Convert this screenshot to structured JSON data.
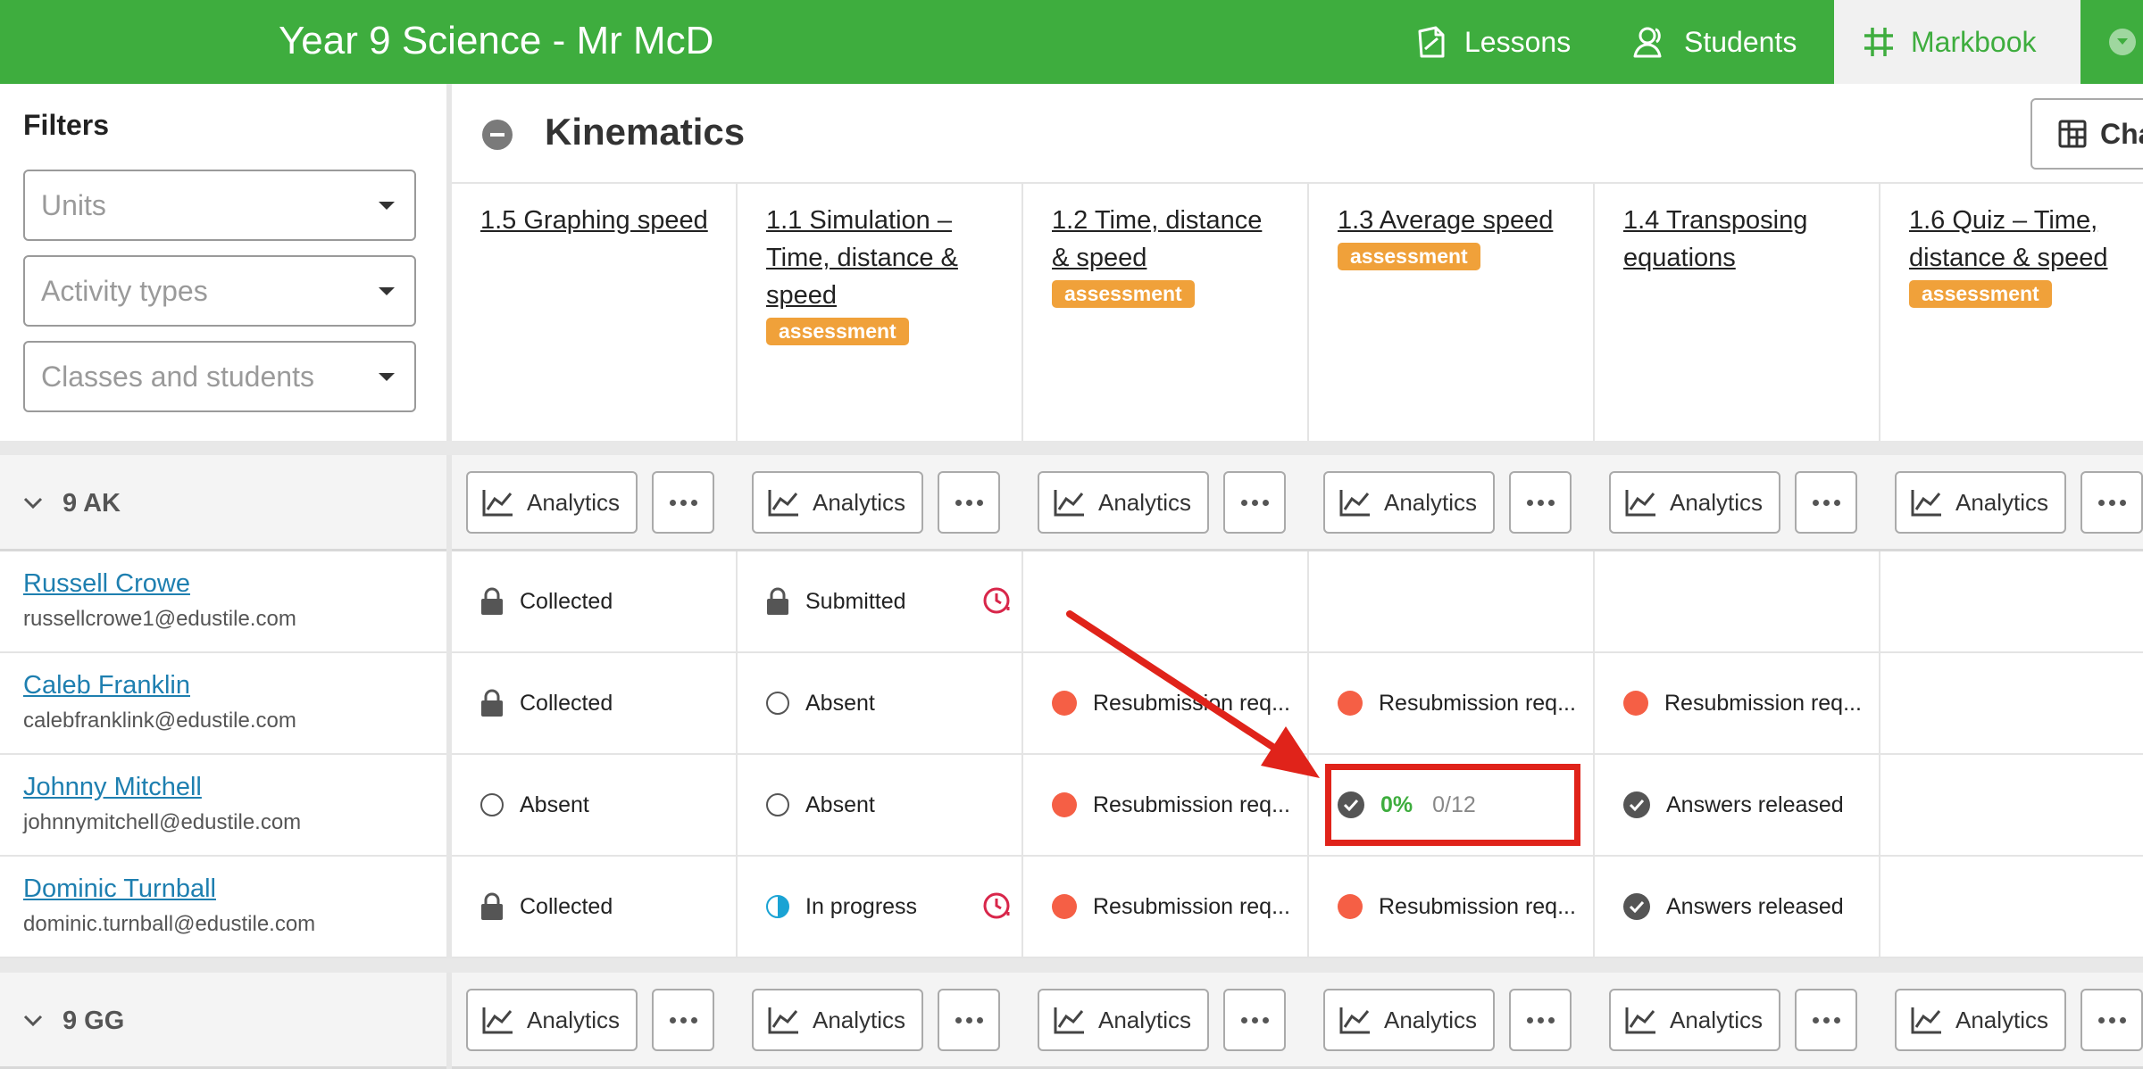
{
  "header": {
    "course_title": "Year 9 Science - Mr McD",
    "nav": {
      "lessons": "Lessons",
      "students": "Students",
      "markbook": "Markbook"
    }
  },
  "filters": {
    "title": "Filters",
    "units_placeholder": "Units",
    "activity_types_placeholder": "Activity types",
    "classes_placeholder": "Classes and students"
  },
  "unit": {
    "title": "Kinematics",
    "change_button": "Cha"
  },
  "activities": [
    {
      "title": "1.5 Graphing speed",
      "badge": ""
    },
    {
      "title": "1.1 Simulation – Time, distance & speed",
      "badge": "assessment"
    },
    {
      "title": "1.2 Time, distance & speed",
      "badge": "assessment"
    },
    {
      "title": "1.3 Average speed",
      "badge": "assessment"
    },
    {
      "title": "1.4 Transposing equations",
      "badge": ""
    },
    {
      "title": "1.6 Quiz – Time, distance & speed",
      "badge": "assessment"
    }
  ],
  "labels": {
    "analytics": "Analytics"
  },
  "classes": [
    {
      "name": "9 AK",
      "students": [
        {
          "name": "Russell Crowe",
          "email": "russellcrowe1@edustile.com",
          "cells": [
            {
              "status": "Collected",
              "icon": "lock-icon"
            },
            {
              "status": "Submitted",
              "icon": "lock-icon",
              "late": true
            },
            {
              "status": "",
              "icon": ""
            },
            {
              "status": "",
              "icon": ""
            },
            {
              "status": "",
              "icon": ""
            },
            {
              "status": "",
              "icon": ""
            }
          ]
        },
        {
          "name": "Caleb Franklin",
          "email": "calebfranklink@edustile.com",
          "cells": [
            {
              "status": "Collected",
              "icon": "lock-icon"
            },
            {
              "status": "Absent",
              "icon": "absent-circle-icon"
            },
            {
              "status": "Resubmission req...",
              "icon": "red-dot-icon"
            },
            {
              "status": "Resubmission req...",
              "icon": "red-dot-icon"
            },
            {
              "status": "Resubmission req...",
              "icon": "red-dot-icon"
            },
            {
              "status": "",
              "icon": ""
            }
          ]
        },
        {
          "name": "Johnny Mitchell",
          "email": "johnnymitchell@edustile.com",
          "cells": [
            {
              "status": "Absent",
              "icon": "absent-circle-icon"
            },
            {
              "status": "Absent",
              "icon": "absent-circle-icon"
            },
            {
              "status": "Resubmission req...",
              "icon": "red-dot-icon"
            },
            {
              "status": "",
              "icon": "check-circle-icon",
              "percent": "0%",
              "score": "0/12"
            },
            {
              "status": "Answers released",
              "icon": "check-circle-icon"
            },
            {
              "status": "",
              "icon": ""
            }
          ]
        },
        {
          "name": "Dominic Turnball",
          "email": "dominic.turnball@edustile.com",
          "cells": [
            {
              "status": "Collected",
              "icon": "lock-icon"
            },
            {
              "status": "In progress",
              "icon": "in-progress-icon",
              "late": true
            },
            {
              "status": "Resubmission req...",
              "icon": "red-dot-icon"
            },
            {
              "status": "Resubmission req...",
              "icon": "red-dot-icon"
            },
            {
              "status": "Answers released",
              "icon": "check-circle-icon"
            },
            {
              "status": "",
              "icon": ""
            }
          ]
        }
      ]
    },
    {
      "name": "9 GG",
      "students": []
    }
  ],
  "colors": {
    "brand_green": "#3ead3e",
    "assessment_badge": "#f0a13a",
    "resubmission_red": "#f55f45",
    "link_blue": "#1e7fb0",
    "highlight_red": "#e0231a"
  }
}
